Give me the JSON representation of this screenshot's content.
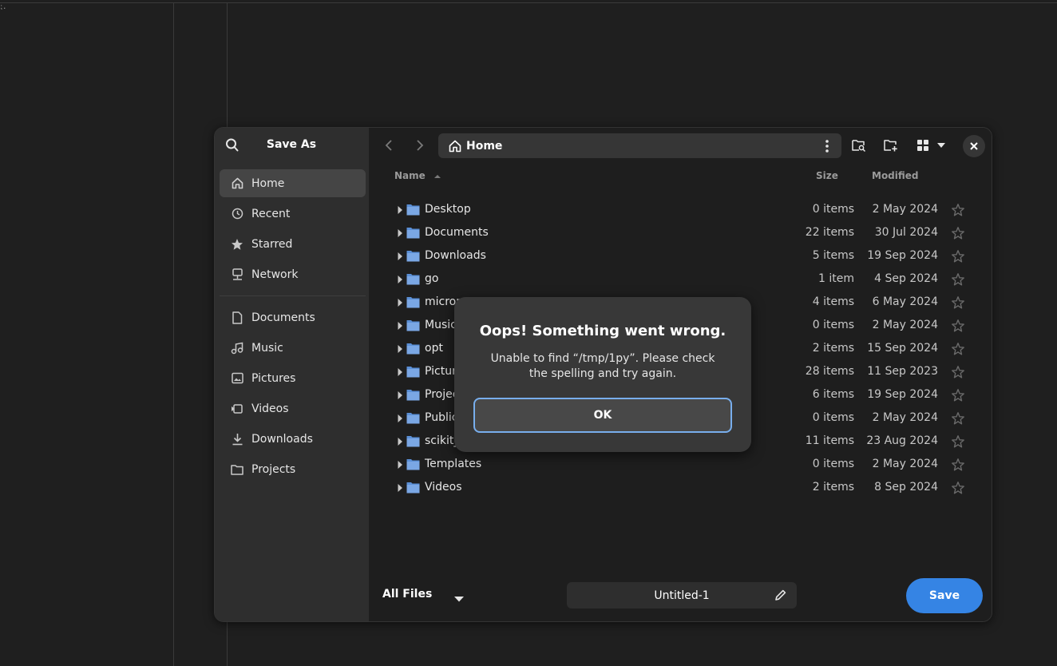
{
  "background": {
    "corner_mark": "⁏."
  },
  "dialog": {
    "title": "Save As",
    "icons": {
      "search": "search-icon"
    },
    "sidebar": {
      "places": [
        {
          "label": "Home",
          "icon": "home-icon",
          "active": true
        },
        {
          "label": "Recent",
          "icon": "clock-icon",
          "active": false
        },
        {
          "label": "Starred",
          "icon": "star-icon",
          "active": false
        },
        {
          "label": "Network",
          "icon": "network-icon",
          "active": false
        }
      ],
      "bookmarks": [
        {
          "label": "Documents",
          "icon": "document-icon"
        },
        {
          "label": "Music",
          "icon": "music-icon"
        },
        {
          "label": "Pictures",
          "icon": "picture-icon"
        },
        {
          "label": "Videos",
          "icon": "video-icon"
        },
        {
          "label": "Downloads",
          "icon": "download-icon"
        },
        {
          "label": "Projects",
          "icon": "folder-icon"
        }
      ]
    },
    "toolbar": {
      "location": "Home"
    },
    "columns": {
      "name": "Name",
      "size": "Size",
      "modified": "Modified"
    },
    "files": [
      {
        "name": "Desktop",
        "size": "0 items",
        "modified": "2 May 2024"
      },
      {
        "name": "Documents",
        "size": "22 items",
        "modified": "30 Jul 2024"
      },
      {
        "name": "Downloads",
        "size": "5 items",
        "modified": "19 Sep 2024"
      },
      {
        "name": "go",
        "size": "1 item",
        "modified": "4 Sep 2024"
      },
      {
        "name": "microm",
        "size": "4 items",
        "modified": "6 May 2024"
      },
      {
        "name": "Music",
        "size": "0 items",
        "modified": "2 May 2024"
      },
      {
        "name": "opt",
        "size": "2 items",
        "modified": "15 Sep 2024"
      },
      {
        "name": "Pictur",
        "size": "28 items",
        "modified": "11 Sep 2023"
      },
      {
        "name": "Projec",
        "size": "6 items",
        "modified": "19 Sep 2024"
      },
      {
        "name": "Public",
        "size": "0 items",
        "modified": "2 May 2024"
      },
      {
        "name": "scikit_",
        "size": "11 items",
        "modified": "23 Aug 2024"
      },
      {
        "name": "Templates",
        "size": "0 items",
        "modified": "2 May 2024"
      },
      {
        "name": "Videos",
        "size": "2 items",
        "modified": "8 Sep 2024"
      }
    ],
    "footer": {
      "filter": "All Files",
      "filename": "Untitled-1",
      "save_label": "Save"
    }
  },
  "error": {
    "title": "Oops! Something went wrong.",
    "message": "Unable to find “/tmp/1py”. Please check the spelling and try again.",
    "ok_label": "OK"
  },
  "colors": {
    "accent": "#3584e4",
    "focus_ring": "#78aeed",
    "folder": "#5a8fd6"
  }
}
